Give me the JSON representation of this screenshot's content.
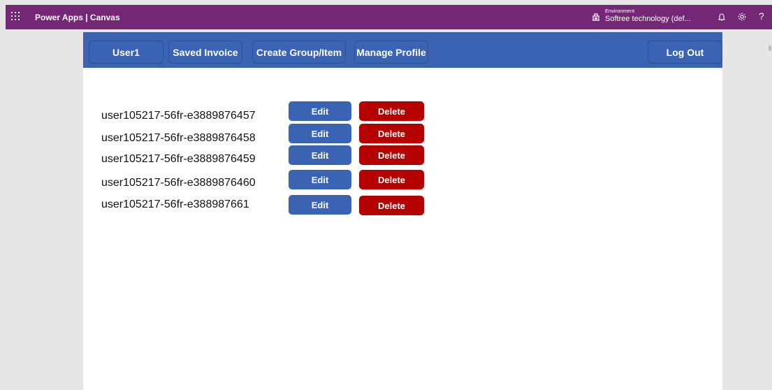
{
  "topbar": {
    "app_title": "Power Apps | Canvas",
    "environment_label": "Environment",
    "environment_name": "Softree technology (def...",
    "help_glyph": "?"
  },
  "nav": {
    "user": "User1",
    "saved_invoice": "Saved Invoice",
    "create_group": "Create Group/Item",
    "manage_profile": "Manage Profile",
    "log_out": "Log Out"
  },
  "rows": [
    {
      "label": "user105217-56fr-e3889876457",
      "edit": "Edit",
      "delete": "Delete"
    },
    {
      "label": "user105217-56fr-e3889876458",
      "edit": "Edit",
      "delete": "Delete"
    },
    {
      "label": "user105217-56fr-e3889876459",
      "edit": "Edit",
      "delete": "Delete"
    },
    {
      "label": "user105217-56fr-e3889876460",
      "edit": "Edit",
      "delete": "Delete"
    },
    {
      "label": "user105217-56fr-e388987661",
      "edit": "Edit",
      "delete": "Delete"
    }
  ],
  "colors": {
    "topbar": "#742774",
    "nav_blue": "#3a63b4",
    "delete_red": "#b50000"
  },
  "icons": {
    "waffle": "waffle-icon",
    "environment": "environment-icon",
    "notifications": "bell-icon",
    "settings": "gear-icon",
    "help": "help-icon"
  }
}
